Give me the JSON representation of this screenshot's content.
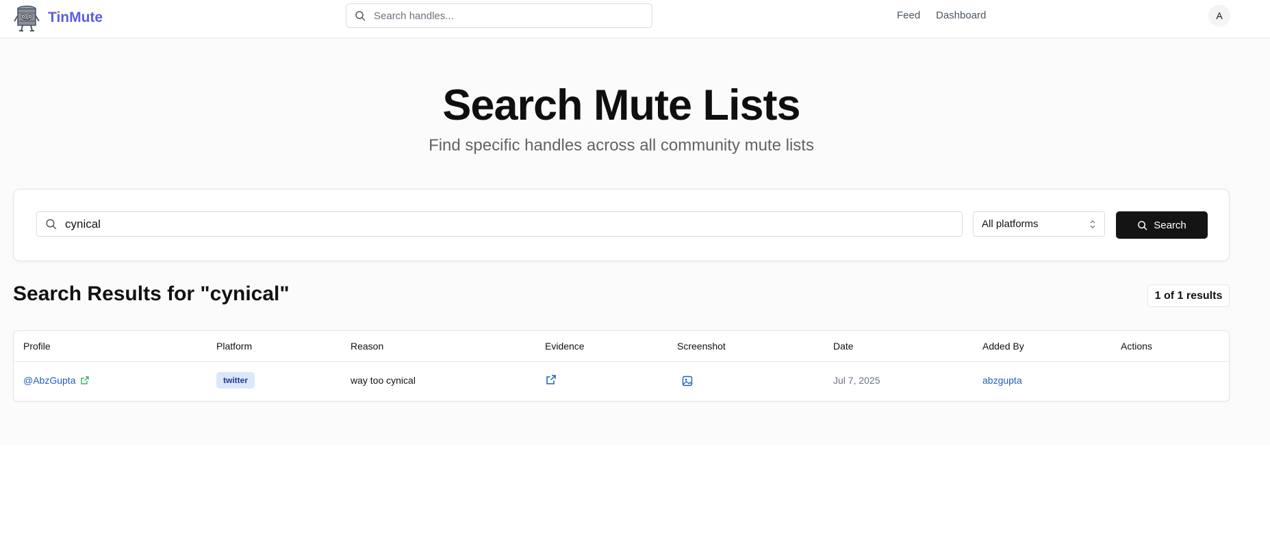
{
  "header": {
    "brand_name": "TinMute",
    "search_placeholder": "Search handles...",
    "nav": {
      "feed": "Feed",
      "dashboard": "Dashboard"
    },
    "avatar_initial": "A"
  },
  "hero": {
    "title": "Search Mute Lists",
    "subtitle": "Find specific handles across all community mute lists"
  },
  "search": {
    "query": "cynical",
    "platform_selected": "All platforms",
    "button_label": "Search"
  },
  "results": {
    "title": "Search Results for \"cynical\"",
    "count_label": "1 of 1 results",
    "columns": [
      "Profile",
      "Platform",
      "Reason",
      "Evidence",
      "Screenshot",
      "Date",
      "Added By",
      "Actions"
    ],
    "rows": [
      {
        "profile": "@AbzGupta",
        "platform": "twitter",
        "reason": "way too cynical",
        "date": "Jul 7, 2025",
        "added_by": "abzgupta"
      }
    ]
  },
  "colors": {
    "brand": "#5b5fe0",
    "link": "#1d5fbf",
    "button_bg": "#141414",
    "badge_bg": "#dbe7fb"
  },
  "icons": {
    "logo": "tin-can-mascot-icon",
    "search": "search-icon",
    "select": "chevron-updown-icon",
    "external_link": "external-link-icon",
    "screenshot": "image-icon"
  }
}
